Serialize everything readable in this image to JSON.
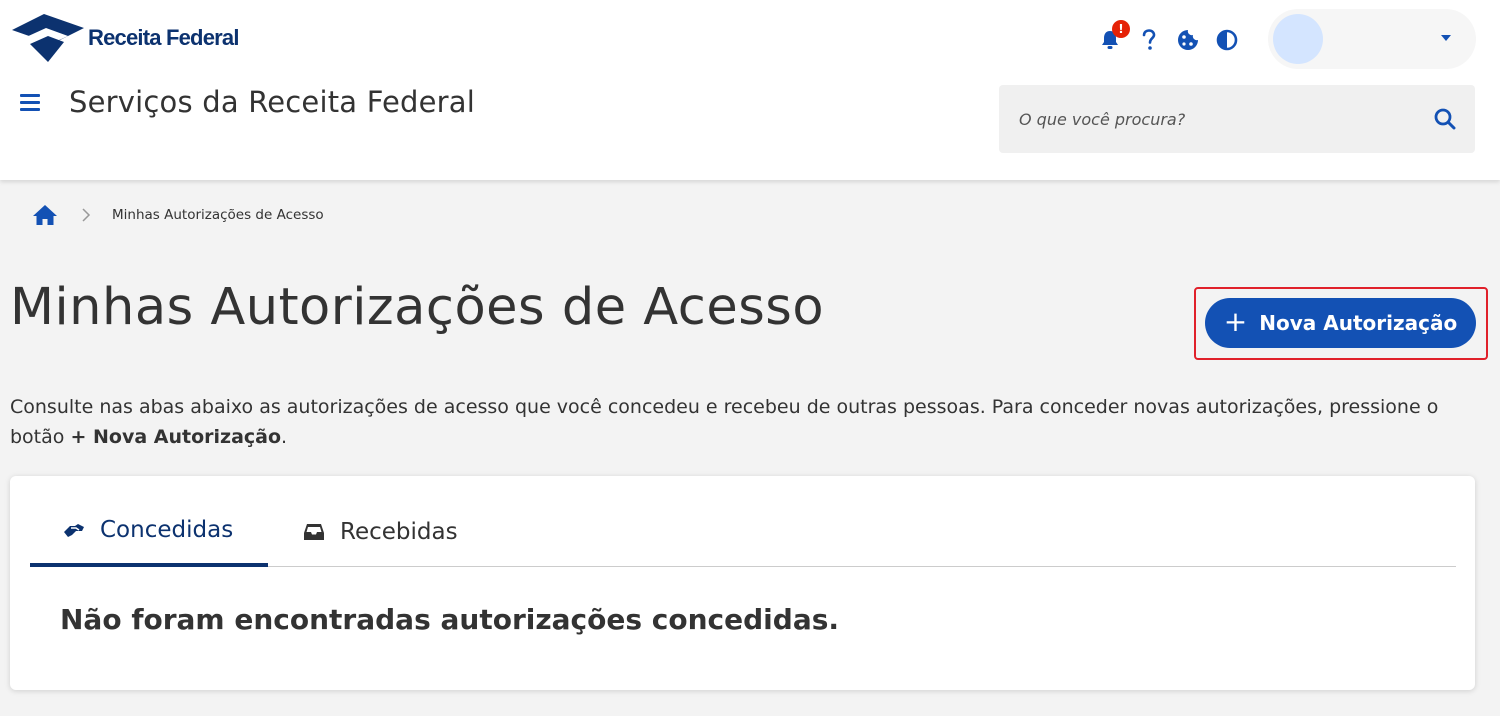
{
  "brand": {
    "logo_text": "Receita Federal"
  },
  "header": {
    "site_title": "Serviços da Receita Federal",
    "notification_badge": "!",
    "search_placeholder": "O que você procura?"
  },
  "breadcrumb": {
    "current": "Minhas Autorizações de Acesso"
  },
  "page": {
    "title": "Minhas Autorizações de Acesso",
    "new_button_icon": "+",
    "new_button_label": "Nova Autorização",
    "description_prefix": "Consulte nas abas abaixo as autorizações de acesso que você concedeu e recebeu de outras pessoas. Para conceder novas autorizações, pressione o botão ",
    "description_button_ref": "+ Nova Autorização",
    "description_suffix": "."
  },
  "tabs": [
    {
      "label": "Concedidas",
      "icon": "handshake-icon",
      "active": true
    },
    {
      "label": "Recebidas",
      "icon": "inbox-icon",
      "active": false
    }
  ],
  "content": {
    "empty_message": "Não foram encontradas autorizações concedidas."
  },
  "colors": {
    "primary": "#1351b4",
    "dark_blue": "#0c326f",
    "badge_red": "#e52207",
    "highlight_red": "#e0202a"
  }
}
